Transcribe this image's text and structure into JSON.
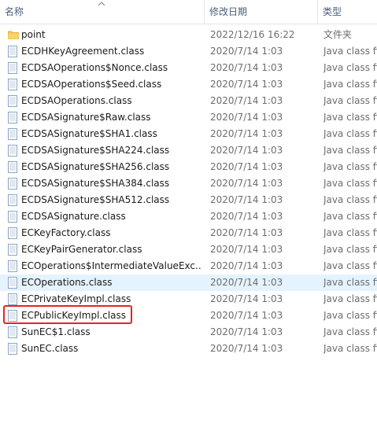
{
  "header": {
    "name_label": "名称",
    "date_label": "修改日期",
    "type_label": "类型"
  },
  "files": [
    {
      "name": "point",
      "date": "2022/12/16 16:22",
      "type": "文件夹",
      "icon": "folder-icon"
    },
    {
      "name": "ECDHKeyAgreement.class",
      "date": "2020/7/14 1:03",
      "type": "Java class file",
      "icon": "class-file-icon"
    },
    {
      "name": "ECDSAOperations$Nonce.class",
      "date": "2020/7/14 1:03",
      "type": "Java class file",
      "icon": "class-file-icon"
    },
    {
      "name": "ECDSAOperations$Seed.class",
      "date": "2020/7/14 1:03",
      "type": "Java class file",
      "icon": "class-file-icon"
    },
    {
      "name": "ECDSAOperations.class",
      "date": "2020/7/14 1:03",
      "type": "Java class file",
      "icon": "class-file-icon"
    },
    {
      "name": "ECDSASignature$Raw.class",
      "date": "2020/7/14 1:03",
      "type": "Java class file",
      "icon": "class-file-icon"
    },
    {
      "name": "ECDSASignature$SHA1.class",
      "date": "2020/7/14 1:03",
      "type": "Java class file",
      "icon": "class-file-icon"
    },
    {
      "name": "ECDSASignature$SHA224.class",
      "date": "2020/7/14 1:03",
      "type": "Java class file",
      "icon": "class-file-icon"
    },
    {
      "name": "ECDSASignature$SHA256.class",
      "date": "2020/7/14 1:03",
      "type": "Java class file",
      "icon": "class-file-icon"
    },
    {
      "name": "ECDSASignature$SHA384.class",
      "date": "2020/7/14 1:03",
      "type": "Java class file",
      "icon": "class-file-icon"
    },
    {
      "name": "ECDSASignature$SHA512.class",
      "date": "2020/7/14 1:03",
      "type": "Java class file",
      "icon": "class-file-icon"
    },
    {
      "name": "ECDSASignature.class",
      "date": "2020/7/14 1:03",
      "type": "Java class file",
      "icon": "class-file-icon"
    },
    {
      "name": "ECKeyFactory.class",
      "date": "2020/7/14 1:03",
      "type": "Java class file",
      "icon": "class-file-icon"
    },
    {
      "name": "ECKeyPairGenerator.class",
      "date": "2020/7/14 1:03",
      "type": "Java class file",
      "icon": "class-file-icon"
    },
    {
      "name": "ECOperations$IntermediateValueExc...",
      "date": "2020/7/14 1:03",
      "type": "Java class file",
      "icon": "class-file-icon"
    },
    {
      "name": "ECOperations.class",
      "date": "2020/7/14 1:03",
      "type": "Java class file",
      "icon": "class-file-icon",
      "hovered": true
    },
    {
      "name": "ECPrivateKeyImpl.class",
      "date": "2020/7/14 1:03",
      "type": "Java class file",
      "icon": "class-file-icon"
    },
    {
      "name": "ECPublicKeyImpl.class",
      "date": "2020/7/14 1:03",
      "type": "Java class file",
      "icon": "class-file-icon",
      "annotated": true
    },
    {
      "name": "SunEC$1.class",
      "date": "2020/7/14 1:03",
      "type": "Java class file",
      "icon": "class-file-icon"
    },
    {
      "name": "SunEC.class",
      "date": "2020/7/14 1:03",
      "type": "Java class file",
      "icon": "class-file-icon"
    }
  ],
  "colors": {
    "header_text": "#4c607a",
    "hover_row": "#e5f3ff",
    "annotation_border": "#e8231f",
    "folder": "#f3c845"
  }
}
